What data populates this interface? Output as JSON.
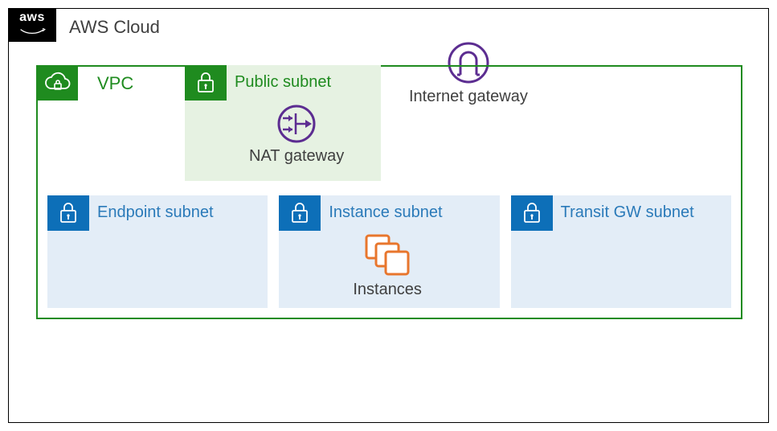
{
  "cloud": {
    "label": "AWS Cloud",
    "logo_text": "aws"
  },
  "vpc": {
    "label": "VPC"
  },
  "internet_gateway": {
    "label": "Internet gateway"
  },
  "public_subnet": {
    "label": "Public subnet",
    "nat_gateway_label": "NAT gateway"
  },
  "private_subnets": {
    "endpoint": {
      "label": "Endpoint subnet"
    },
    "instance": {
      "label": "Instance subnet",
      "instances_label": "Instances"
    },
    "transit": {
      "label": "Transit GW subnet"
    }
  }
}
